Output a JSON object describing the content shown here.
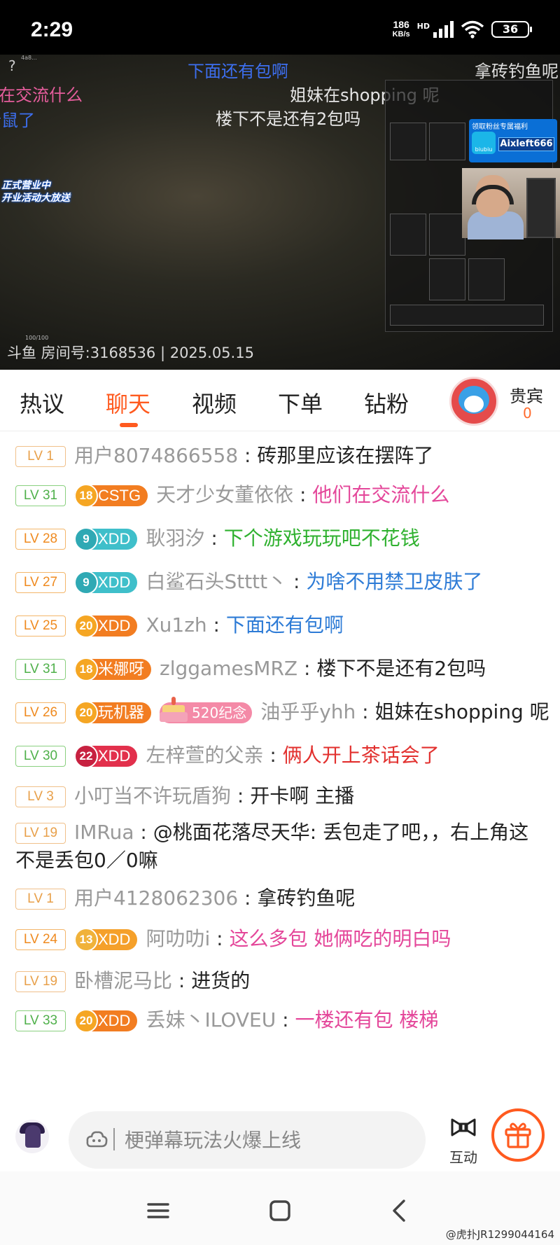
{
  "status_bar": {
    "time": "2:29",
    "speed_value": "186",
    "speed_unit": "KB/s",
    "network_tag": "HD",
    "battery": "36"
  },
  "video": {
    "help_glyph": "?",
    "danmaku": [
      "下面还有包啊",
      "拿砖钓鱼呢",
      "在交流什么",
      "姐妹在shopping 呢",
      "老鼠了",
      "楼下不是还有2包吗"
    ],
    "promo_lines": [
      "正式营业中",
      "开业活动大放送"
    ],
    "watermark": "斗鱼 房间号:3168536 | 2025.05.15",
    "fan_banner_title": "领取粉丝专属福利",
    "fan_banner_name": "Aixleft666",
    "biubiu_label": "biubiu"
  },
  "tabs": [
    {
      "label": "热议",
      "active": false
    },
    {
      "label": "聊天",
      "active": true
    },
    {
      "label": "视频",
      "active": false
    },
    {
      "label": "下单",
      "active": false
    },
    {
      "label": "钻粉",
      "active": false
    }
  ],
  "guest": {
    "label": "贵宾",
    "count": "0"
  },
  "chat": [
    {
      "lv": "LV 1",
      "user": "用户8074866558",
      "text": "砖那里应该在摆阵了",
      "color": "black"
    },
    {
      "lv": "LV 31",
      "badge_num": "18",
      "badge": "CSTG",
      "user": "天才少女董依依",
      "text": "他们在交流什么",
      "color": "pink"
    },
    {
      "lv": "LV 28",
      "badge_num": "9",
      "badge": "XDD",
      "user": "耿羽汐",
      "text": "下个游戏玩玩吧不花钱",
      "color": "green"
    },
    {
      "lv": "LV 27",
      "badge_num": "9",
      "badge": "XDD",
      "user": "白鲨石头Stttt丶",
      "text": "为啥不用禁卫皮肤了",
      "color": "blue"
    },
    {
      "lv": "LV 25",
      "badge_num": "20",
      "badge": "XDD",
      "user": "Xu1zh",
      "text": "下面还有包啊",
      "color": "blue"
    },
    {
      "lv": "LV 31",
      "badge_num": "18",
      "badge": "米娜呀",
      "user": "zlggamesMRZ",
      "text": "楼下不是还有2包吗",
      "color": "black"
    },
    {
      "lv": "LV 26",
      "badge_num": "20",
      "badge": "玩机器",
      "memo": "520纪念",
      "user": "油乎乎yhh",
      "text": "姐妹在shopping 呢",
      "color": "black"
    },
    {
      "lv": "LV 30",
      "badge_num": "22",
      "badge": "XDD",
      "user": "左梓萱的父亲",
      "text": "俩人开上茶话会了",
      "color": "red"
    },
    {
      "lv": "LV 3",
      "user": "小叮当不许玩盾狗",
      "text": "开卡啊 主播",
      "color": "black"
    },
    {
      "lv": "LV 19",
      "user": "IMRua",
      "text": "@桃面花落尽天华: 丢包走了吧，，右上角这不是丢包0／0嘛",
      "color": "black"
    },
    {
      "lv": "LV 1",
      "user": "用户4128062306",
      "text": "拿砖钓鱼呢",
      "color": "black"
    },
    {
      "lv": "LV 24",
      "badge_num": "13",
      "badge": "XDD",
      "user": "阿叻叻i",
      "text": "这么多包 她俩吃的明白吗",
      "color": "pink"
    },
    {
      "lv": "LV 19",
      "user": "卧槽泥马比",
      "text": "进货的",
      "color": "black"
    },
    {
      "lv": "LV 33",
      "badge_num": "20",
      "badge": "XDD",
      "user": "丢妹丶ILOVEU",
      "text": "一楼还有包 楼梯",
      "color": "pink"
    }
  ],
  "input": {
    "placeholder": "梗弹幕玩法火爆上线",
    "interact_label": "互动"
  },
  "credit": "@虎扑JR1299044164",
  "icons": {
    "interact": "bow-tie-icon",
    "gift": "gift-icon",
    "danmaku_style": "cloud-bubble-icon",
    "nav_menu": "menu-icon",
    "nav_home": "square-home-icon",
    "nav_back": "back-chevron-icon"
  },
  "colors": {
    "accent": "#ff5a1f",
    "msg_pink": "#e4479a",
    "msg_green": "#2fb12f",
    "msg_blue": "#2d7bd6",
    "msg_red": "#e2302e"
  }
}
